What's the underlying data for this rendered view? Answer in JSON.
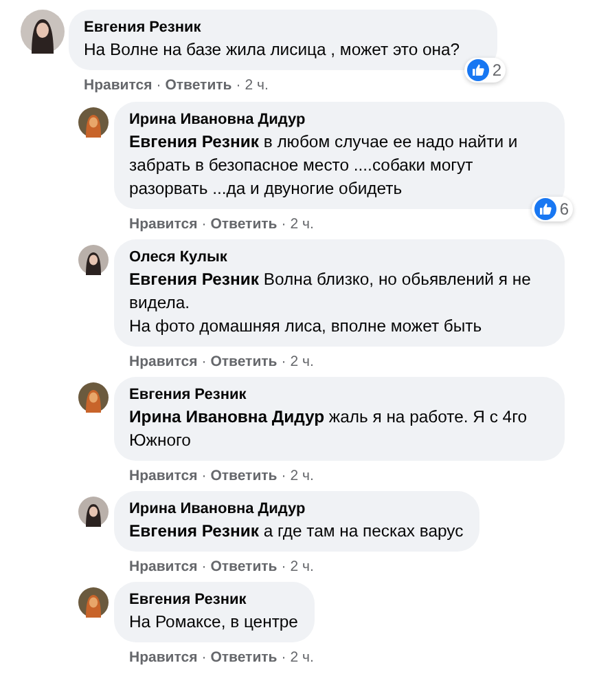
{
  "separator": "·",
  "comment": {
    "author": "Евгения Резник",
    "text": "На Волне на базе жила лисица , может это она?",
    "reactions": "2",
    "actions": {
      "like": "Нравится",
      "reply": "Ответить",
      "time": "2 ч."
    }
  },
  "replies": [
    {
      "author": "Ирина Ивановна Дидур",
      "text": "**Евгения Резник** в любом случае ее надо найти и забрать в безопасное место ....собаки могут разорвать ...да и двуногие обидеть",
      "reactions": "6",
      "actions": {
        "like": "Нравится",
        "reply": "Ответить",
        "time": "2 ч."
      }
    },
    {
      "author": "Олеся Кулык",
      "text": "**Евгения Резник** Волна близко, но обьявлений я не видела.\nНа фото домашняя лиса, вполне может быть",
      "actions": {
        "like": "Нравится",
        "reply": "Ответить",
        "time": "2 ч."
      }
    },
    {
      "author": "Евгения Резник",
      "text": "**Ирина Ивановна Дидур** жаль я на работе. Я с 4го Южного",
      "actions": {
        "like": "Нравится",
        "reply": "Ответить",
        "time": "2 ч."
      }
    },
    {
      "author": "Ирина Ивановна Дидур",
      "text": "**Евгения Резник** а где там на песках варус",
      "actions": {
        "like": "Нравится",
        "reply": "Ответить",
        "time": "2 ч."
      }
    },
    {
      "author": "Евгения Резник",
      "text": "На Ромаксе, в центре",
      "actions": {
        "like": "Нравится",
        "reply": "Ответить",
        "time": "2 ч."
      }
    }
  ]
}
